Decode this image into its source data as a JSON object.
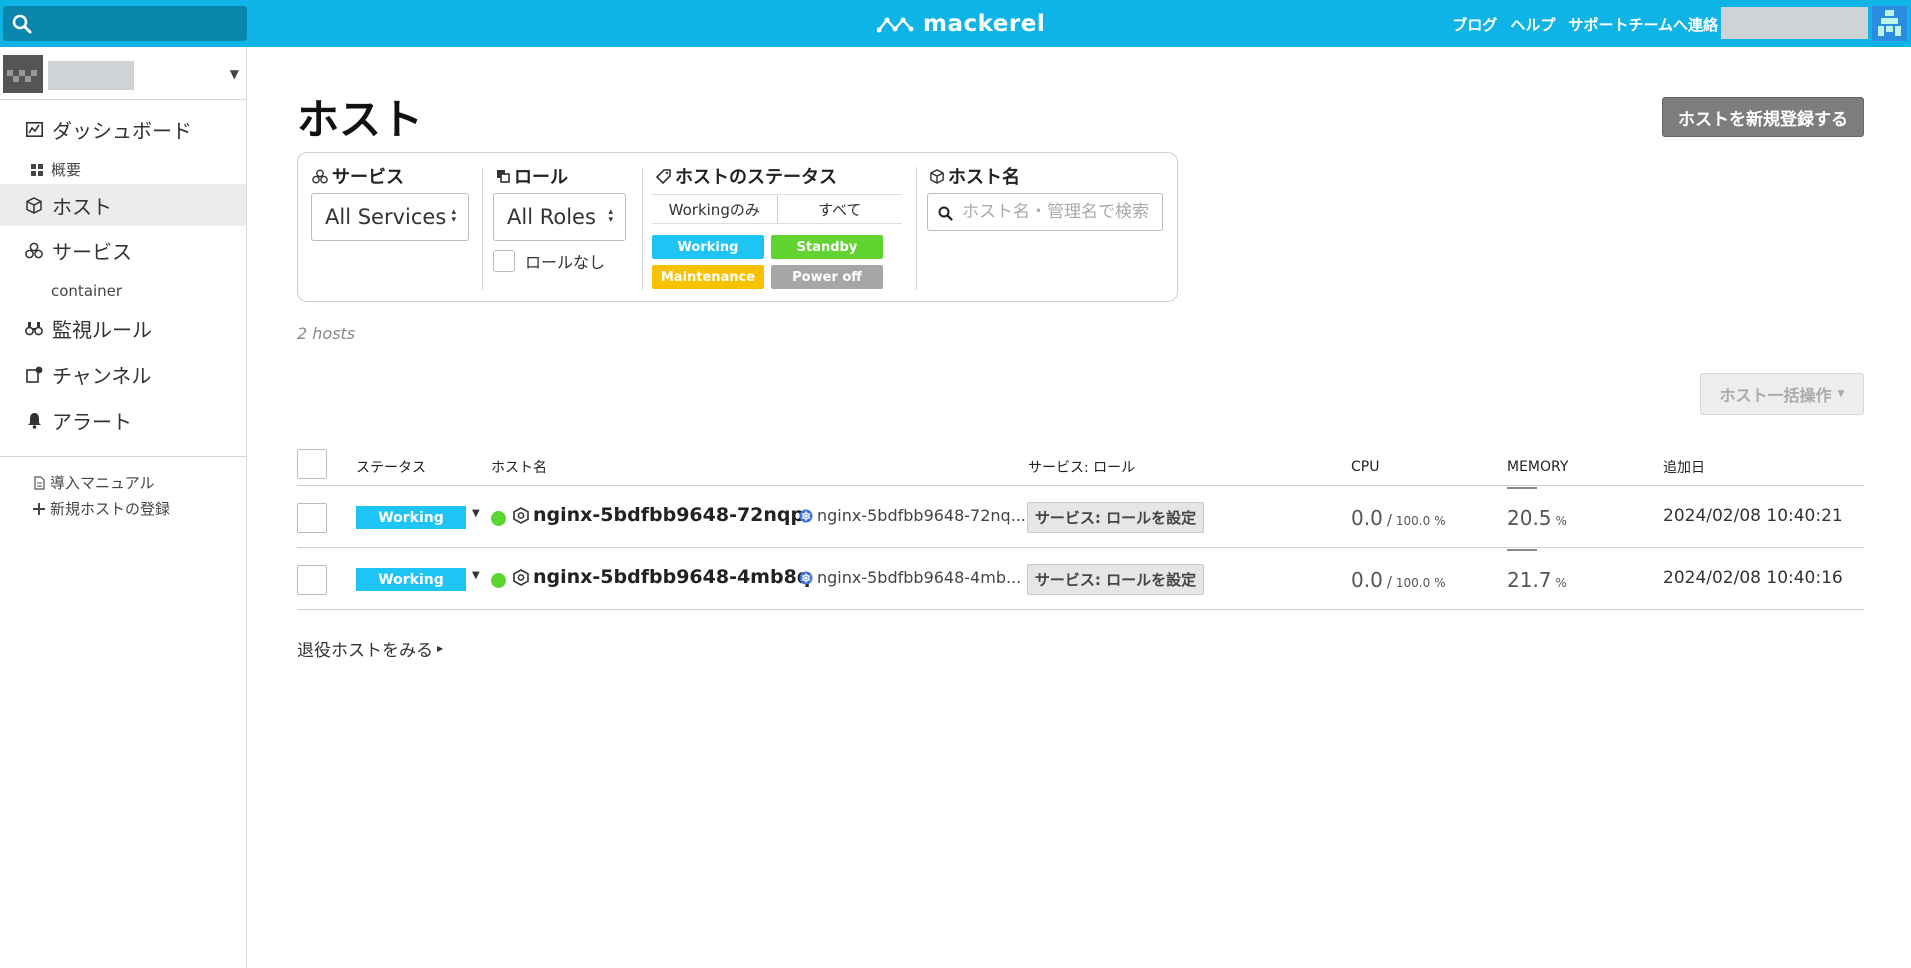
{
  "colors": {
    "topbar": "#0fb4e6",
    "working": "#1ec4f4",
    "standby": "#62d431",
    "maintenance": "#f8c200",
    "power_off": "#a6a6a6",
    "status_dot": "#5dd531"
  },
  "topbar": {
    "logo_text": "mackerel",
    "links": [
      "ブログ",
      "ヘルプ",
      "サポートチームへ連絡"
    ]
  },
  "sidebar": {
    "nav": [
      {
        "label": "ダッシュボード",
        "icon": "chart-icon"
      },
      {
        "label": "ホスト",
        "icon": "cube-icon",
        "active": true
      },
      {
        "label": "サービス",
        "icon": "services-icon"
      },
      {
        "label": "監視ルール",
        "icon": "binoculars-icon"
      },
      {
        "label": "チャンネル",
        "icon": "channel-icon"
      },
      {
        "label": "アラート",
        "icon": "bell-icon"
      }
    ],
    "sub_overview": "概要",
    "sub_container": "container",
    "links": [
      "導入マニュアル",
      "新規ホストの登録"
    ]
  },
  "main": {
    "title": "ホスト",
    "new_host_button": "ホストを新規登録する",
    "filters": {
      "service": {
        "label": "サービス",
        "selected": "All Services"
      },
      "role": {
        "label": "ロール",
        "selected": "All Roles",
        "no_role_label": "ロールなし"
      },
      "status": {
        "label": "ホストのステータス",
        "segment": [
          "Workingのみ",
          "すべて"
        ],
        "tags": [
          "Working",
          "Standby",
          "Maintenance",
          "Power off"
        ]
      },
      "host_name": {
        "label": "ホスト名",
        "placeholder": "ホスト名・管理名で検索"
      }
    },
    "host_count": "2 hosts",
    "bulk_button": "ホスト一括操作",
    "table": {
      "headers": [
        "ステータス",
        "ホスト名",
        "サービス: ロール",
        "CPU",
        "MEMORY",
        "追加日"
      ],
      "rows": [
        {
          "status": "Working",
          "name": "nginx-5bdfbb9648-72nqp",
          "alias": "nginx-5bdfbb9648-72nq...",
          "role_button": "サービス: ロールを設定",
          "cpu": "0.0",
          "cpu_max": "100.0",
          "cpu_unit": "%",
          "memory": "20.5",
          "memory_unit": "%",
          "added": "2024/02/08 10:40:21"
        },
        {
          "status": "Working",
          "name": "nginx-5bdfbb9648-4mb8q",
          "alias": "nginx-5bdfbb9648-4mb...",
          "role_button": "サービス: ロールを設定",
          "cpu": "0.0",
          "cpu_max": "100.0",
          "cpu_unit": "%",
          "memory": "21.7",
          "memory_unit": "%",
          "added": "2024/02/08 10:40:16"
        }
      ]
    },
    "retired_link": "退役ホストをみる"
  }
}
